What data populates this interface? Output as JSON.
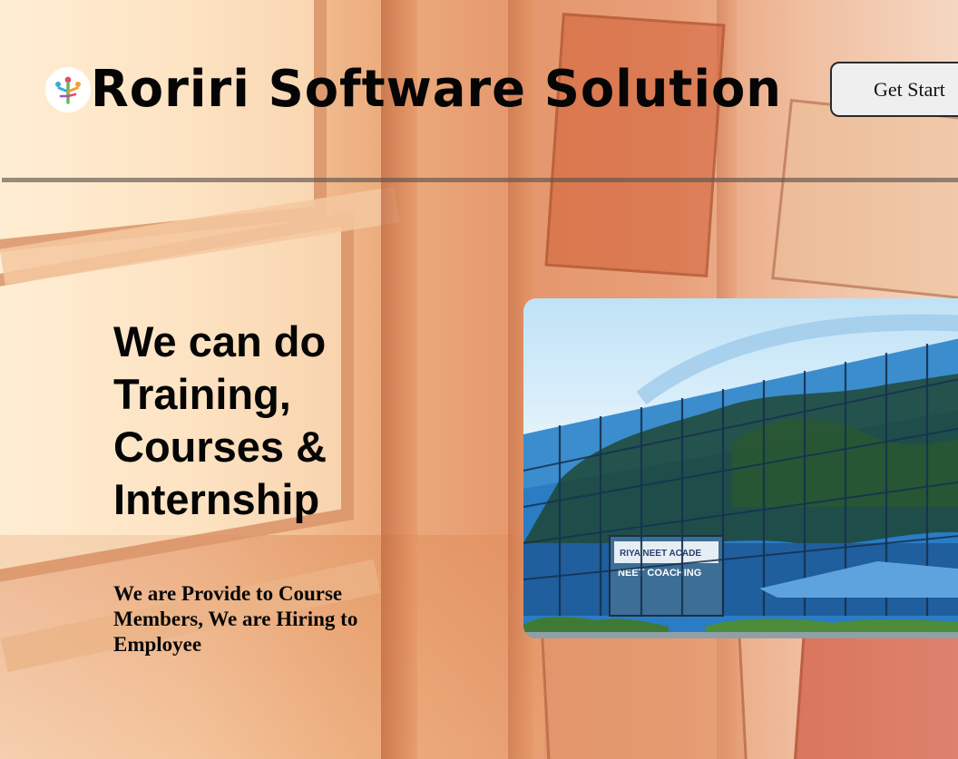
{
  "header": {
    "brand_name": "Roriri Software Solution",
    "logo_icon": "people-tree-logo-icon",
    "cta_label": "Get Start"
  },
  "hero": {
    "headline": "We can do Training, Courses & Internship",
    "subtext": "We are Provide to Course Members, We are Hiring to Employee",
    "image": {
      "subject": "glass-office-building-icon",
      "sign_text": "RIYA NEET ACADE",
      "sign_text_2": "NEET COACHING"
    }
  },
  "colors": {
    "text": "#050505",
    "button_bg": "#efefef",
    "button_border": "#2a2a2a",
    "divider": "#5f5550",
    "building_glass": "#1f6fb8",
    "sky": "#bfe2f6"
  }
}
